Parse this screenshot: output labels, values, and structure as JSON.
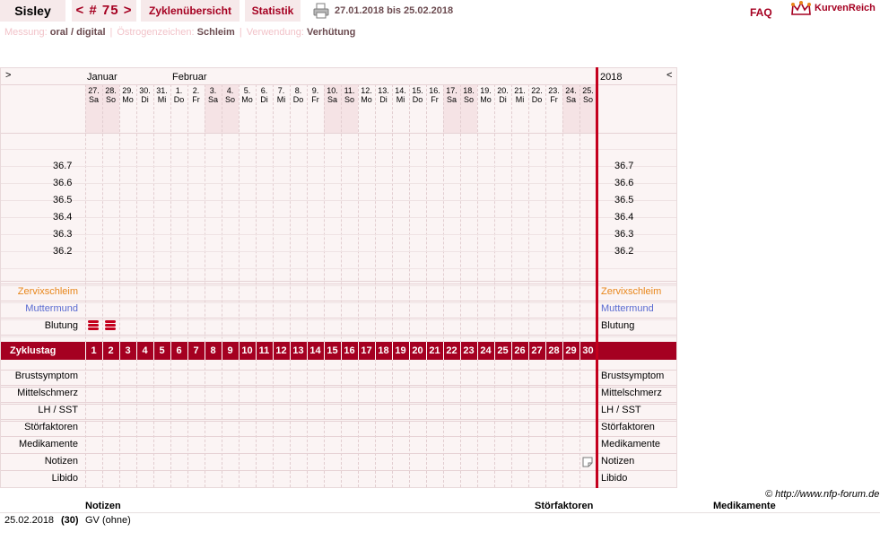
{
  "header": {
    "name": "Sisley",
    "cycle_nav": "< # 75 >",
    "tab_overview": "Zyklenübersicht",
    "tab_stats": "Statistik",
    "date_range": "27.01.2018 bis 25.02.2018",
    "faq": "FAQ",
    "logo_text": "KurvenReich"
  },
  "subheader": {
    "measurement_label": "Messung:",
    "measurement_value": "oral / digital",
    "estrogen_label": "Östrogenzeichen:",
    "estrogen_value": "Schleim",
    "usage_label": "Verwendung:",
    "usage_value": "Verhütung"
  },
  "chart": {
    "left_arrow": ">",
    "right_arrow": "<",
    "year": "2018",
    "month_labels": [
      "Januar",
      "Februar"
    ],
    "days": [
      {
        "num": "27.",
        "wd": "Sa",
        "weekend": true
      },
      {
        "num": "28.",
        "wd": "So",
        "weekend": true
      },
      {
        "num": "29.",
        "wd": "Mo",
        "weekend": false
      },
      {
        "num": "30.",
        "wd": "Di",
        "weekend": false
      },
      {
        "num": "31.",
        "wd": "Mi",
        "weekend": false
      },
      {
        "num": "1.",
        "wd": "Do",
        "weekend": false
      },
      {
        "num": "2.",
        "wd": "Fr",
        "weekend": false
      },
      {
        "num": "3.",
        "wd": "Sa",
        "weekend": true
      },
      {
        "num": "4.",
        "wd": "So",
        "weekend": true
      },
      {
        "num": "5.",
        "wd": "Mo",
        "weekend": false
      },
      {
        "num": "6.",
        "wd": "Di",
        "weekend": false
      },
      {
        "num": "7.",
        "wd": "Mi",
        "weekend": false
      },
      {
        "num": "8.",
        "wd": "Do",
        "weekend": false
      },
      {
        "num": "9.",
        "wd": "Fr",
        "weekend": false
      },
      {
        "num": "10.",
        "wd": "Sa",
        "weekend": true
      },
      {
        "num": "11.",
        "wd": "So",
        "weekend": true
      },
      {
        "num": "12.",
        "wd": "Mo",
        "weekend": false
      },
      {
        "num": "13.",
        "wd": "Di",
        "weekend": false
      },
      {
        "num": "14.",
        "wd": "Mi",
        "weekend": false
      },
      {
        "num": "15.",
        "wd": "Do",
        "weekend": false
      },
      {
        "num": "16.",
        "wd": "Fr",
        "weekend": false
      },
      {
        "num": "17.",
        "wd": "Sa",
        "weekend": true
      },
      {
        "num": "18.",
        "wd": "So",
        "weekend": true
      },
      {
        "num": "19.",
        "wd": "Mo",
        "weekend": false
      },
      {
        "num": "20.",
        "wd": "Di",
        "weekend": false
      },
      {
        "num": "21.",
        "wd": "Mi",
        "weekend": false
      },
      {
        "num": "22.",
        "wd": "Do",
        "weekend": false
      },
      {
        "num": "23.",
        "wd": "Fr",
        "weekend": false
      },
      {
        "num": "24.",
        "wd": "Sa",
        "weekend": true
      },
      {
        "num": "25.",
        "wd": "So",
        "weekend": true
      }
    ],
    "temps": [
      "36.7",
      "36.6",
      "36.5",
      "36.4",
      "36.3",
      "36.2"
    ],
    "rows_top": [
      {
        "label": "Zervixschleim",
        "color": "#e8861a"
      },
      {
        "label": "Muttermund",
        "color": "#5a6bd1"
      },
      {
        "label": "Blutung",
        "color": "#000000"
      }
    ],
    "cycle_label": "Zyklustag",
    "cycle_days": [
      "1",
      "2",
      "3",
      "4",
      "5",
      "6",
      "7",
      "8",
      "9",
      "10",
      "11",
      "12",
      "13",
      "14",
      "15",
      "16",
      "17",
      "18",
      "19",
      "20",
      "21",
      "22",
      "23",
      "24",
      "25",
      "26",
      "27",
      "28",
      "29",
      "30"
    ],
    "rows_bottom": [
      "Brustsymptom",
      "Mittelschmerz",
      "LH / SST",
      "Störfaktoren",
      "Medikamente",
      "Notizen",
      "Libido"
    ],
    "bleeding_day_indices": [
      0,
      1
    ],
    "note_day_index": 29,
    "accent": "#a50021",
    "weekend_color": "#f5e3e5"
  },
  "footer": {
    "copyright": "© http://www.nfp-forum.de",
    "col_notes": "Notizen",
    "col_disturbances": "Störfaktoren",
    "col_medication": "Medikamente",
    "entry_date": "25.02.2018",
    "entry_day": "(30)",
    "entry_note": "GV (ohne)"
  }
}
